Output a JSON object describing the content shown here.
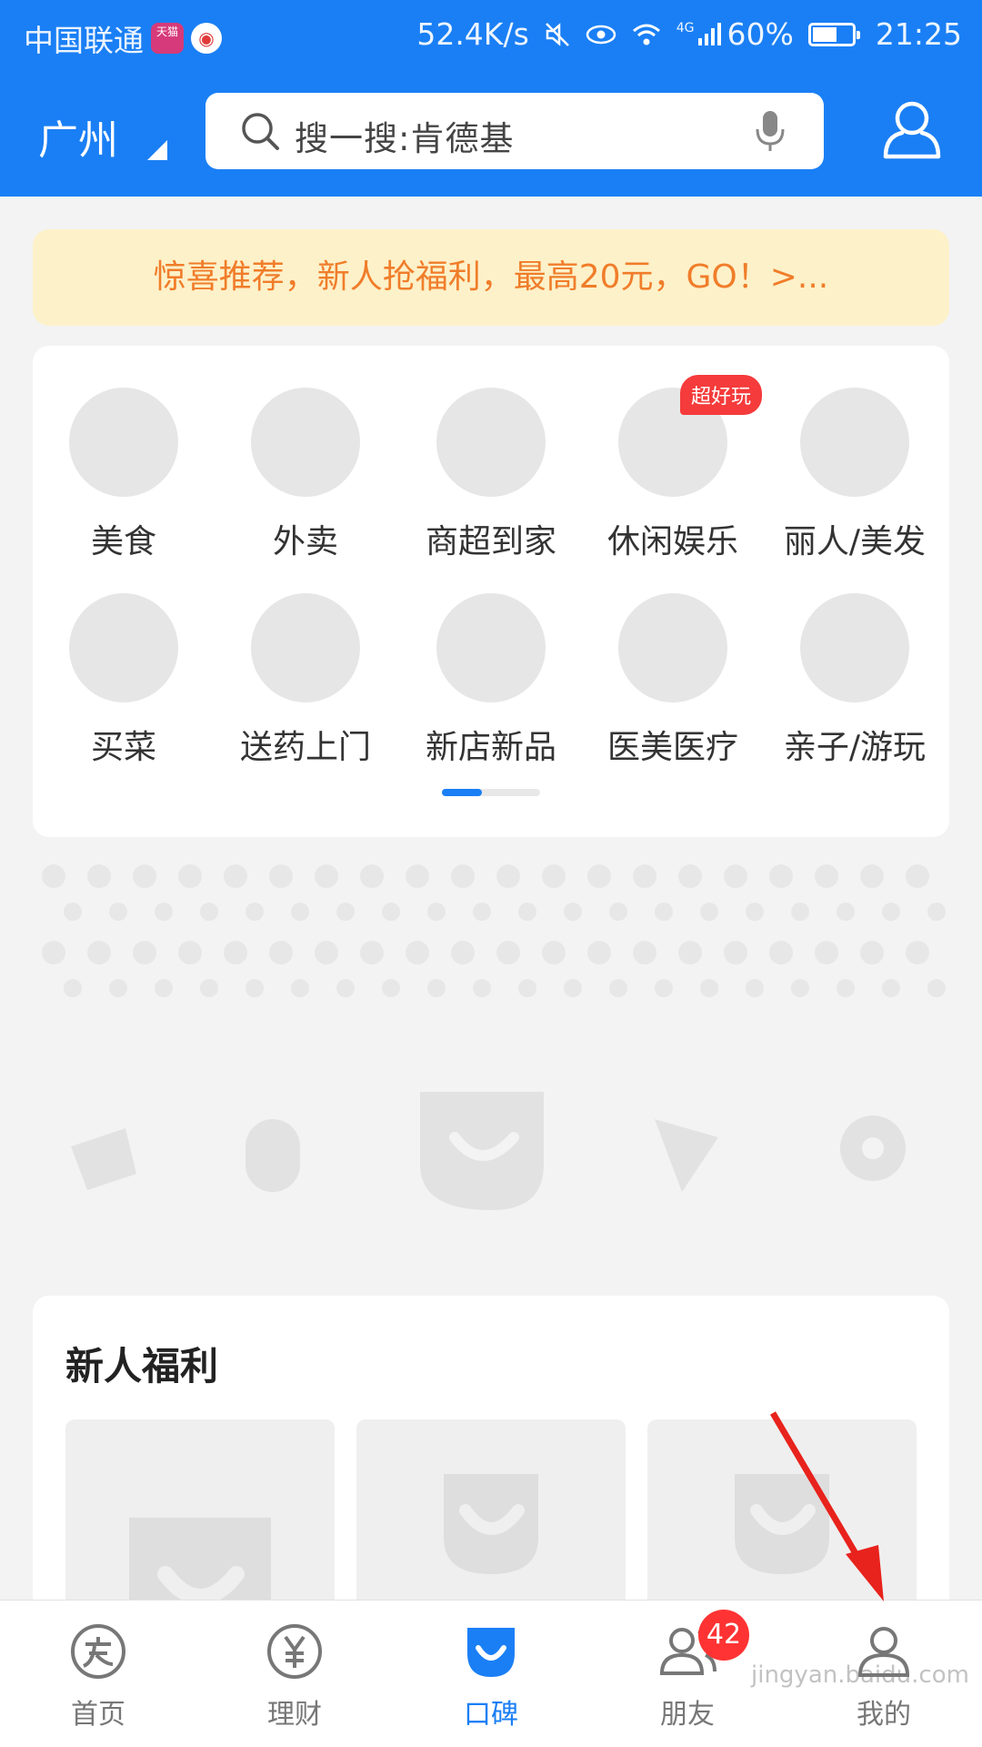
{
  "status_bar": {
    "carrier": "中国联通",
    "tmall_badge": "天猫",
    "net_speed": "52.4K/s",
    "network": "4G",
    "battery": "60%",
    "time": "21:25"
  },
  "header": {
    "city": "广州",
    "search_placeholder": "搜一搜:肯德基"
  },
  "banner": {
    "text": "惊喜推荐，新人抢福利，最高20元，GO！>..."
  },
  "categories": [
    {
      "label": "美食"
    },
    {
      "label": "外卖"
    },
    {
      "label": "商超到家"
    },
    {
      "label": "休闲娱乐",
      "tag": "超好玩"
    },
    {
      "label": "丽人/美发"
    },
    {
      "label": "买菜"
    },
    {
      "label": "送药上门"
    },
    {
      "label": "新店新品"
    },
    {
      "label": "医美医疗"
    },
    {
      "label": "亲子/游玩"
    }
  ],
  "newcomer": {
    "title": "新人福利"
  },
  "tabbar": {
    "tabs": [
      {
        "label": "首页",
        "icon": "alipay-icon"
      },
      {
        "label": "理财",
        "icon": "yuan-icon"
      },
      {
        "label": "口碑",
        "icon": "koubei-icon",
        "active": true
      },
      {
        "label": "朋友",
        "icon": "friends-icon",
        "badge": "42"
      },
      {
        "label": "我的",
        "icon": "profile-icon"
      }
    ]
  },
  "watermark": "jingyan.baidu.com",
  "colors": {
    "brand_blue": "#1a7ff5",
    "banner_bg": "#fdf1c9",
    "banner_text": "#f07d2a",
    "badge_red": "#ff3333"
  }
}
